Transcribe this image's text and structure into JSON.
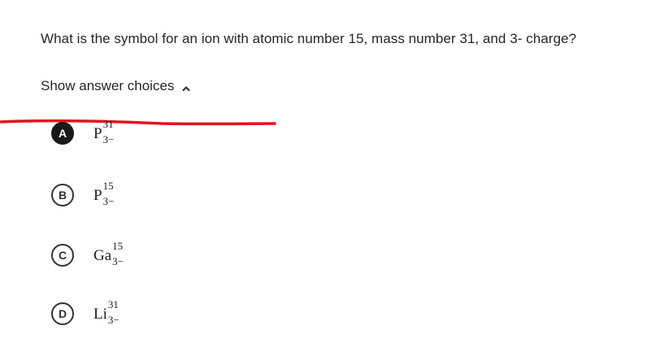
{
  "question": {
    "text": "What is the symbol for an ion with atomic number 15, mass number 31, and 3- charge?"
  },
  "toggle": {
    "label": "Show answer choices",
    "icon": "chevron-up-icon"
  },
  "annotation": {
    "color": "#e0151b"
  },
  "choices": [
    {
      "letter": "A",
      "symbol": "P",
      "sup": "31",
      "sub": "3−",
      "selected": true
    },
    {
      "letter": "B",
      "symbol": "P",
      "sup": "15",
      "sub": "3−",
      "selected": false
    },
    {
      "letter": "C",
      "symbol": "Ga",
      "sup": "15",
      "sub": "3−",
      "selected": false
    },
    {
      "letter": "D",
      "symbol": "Li",
      "sup": "31",
      "sub": "3−",
      "selected": false
    }
  ]
}
